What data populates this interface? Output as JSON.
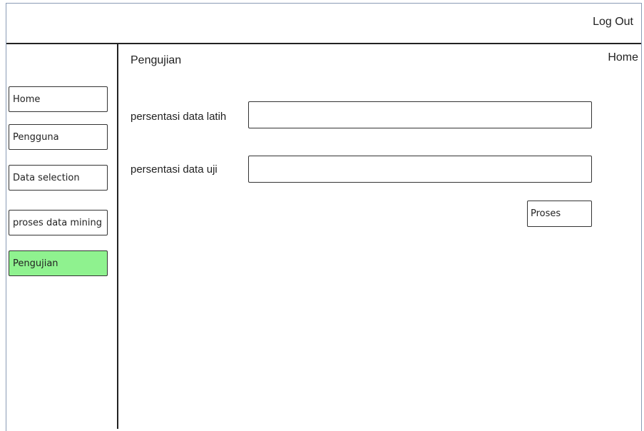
{
  "header": {
    "logout_label": "Log Out"
  },
  "sidebar": {
    "items": [
      {
        "label": "Home",
        "active": false
      },
      {
        "label": "Pengguna",
        "active": false
      },
      {
        "label": "Data selection",
        "active": false
      },
      {
        "label": "proses data mining",
        "active": false
      },
      {
        "label": "Pengujian",
        "active": true
      }
    ]
  },
  "main": {
    "title": "Pengujian",
    "breadcrumb": "Home",
    "fields": [
      {
        "label": "persentasi data latih",
        "value": "",
        "placeholder": ""
      },
      {
        "label": "persentasi data uji",
        "value": "",
        "placeholder": ""
      }
    ],
    "submit_label": "Proses"
  },
  "colors": {
    "active_nav": "#8ff28f",
    "frame_border": "#8a9bb5"
  }
}
